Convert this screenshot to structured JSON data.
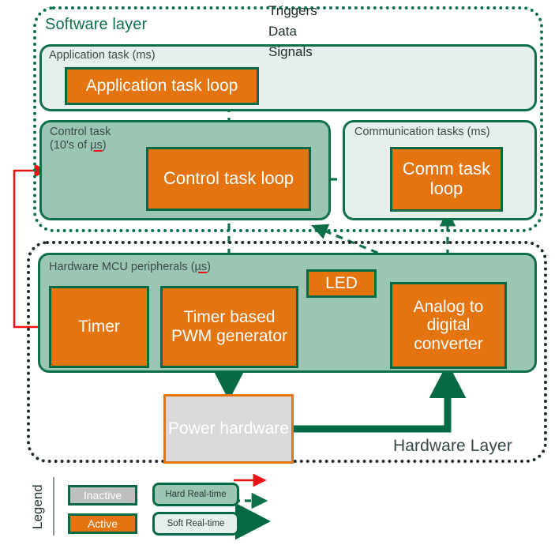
{
  "diagram": {
    "layers": {
      "software": {
        "title": "Software layer"
      },
      "hardware": {
        "title": "Hardware Layer"
      }
    },
    "groups": {
      "application_task": {
        "label": "Application task (ms)",
        "realtime": "soft"
      },
      "control_task": {
        "label": "Control task\n(10's of µs)",
        "label_line1": "Control task",
        "label_line2": "(10's of µs)",
        "realtime": "hard"
      },
      "communication_tasks": {
        "label": "Communication tasks (ms)",
        "realtime": "soft"
      },
      "mcu_peripherals": {
        "label": "Hardware MCU peripherals (µs)",
        "realtime": "hard"
      }
    },
    "blocks": {
      "application_task_loop": {
        "label": "Application task loop",
        "state": "Active"
      },
      "control_task_loop": {
        "label": "Control task loop",
        "state": "Active"
      },
      "comm_task_loop": {
        "label": "Comm task loop",
        "state": "Active"
      },
      "timer": {
        "label": "Timer",
        "state": "Active"
      },
      "pwm_generator": {
        "label": "Timer based PWM generator",
        "state": "Active"
      },
      "led": {
        "label": "LED",
        "state": "Active"
      },
      "adc": {
        "label": "Analog to digital converter",
        "state": "Active"
      },
      "power_hardware": {
        "label": "Power hardware",
        "state": "Inactive"
      }
    },
    "legend": {
      "title": "Legend",
      "state_chips": [
        {
          "label": "Inactive",
          "color": "#bfbfbf"
        },
        {
          "label": "Active",
          "color": "#e3740f"
        }
      ],
      "realtime_pills": [
        {
          "label": "Hard Real-time",
          "color": "#9cc6b4"
        },
        {
          "label": "Soft Real-time",
          "color": "#e6efec"
        }
      ],
      "arrow_kinds": [
        {
          "label": "Triggers",
          "color": "#ee1111",
          "style": "solid-thin"
        },
        {
          "label": "Data",
          "color": "#0d7049",
          "style": "dashed"
        },
        {
          "label": "Signals",
          "color": "#046a43",
          "style": "solid-thick"
        }
      ]
    },
    "colors": {
      "active": "#e3740f",
      "inactive": "#d9d9d9",
      "hard_realtime": "#9cc6b4",
      "soft_realtime": "#e6efec",
      "green_stroke": "#046a43",
      "software_border": "#0d7049",
      "hardware_border": "#1e2d2b",
      "trigger_red": "#ee1111",
      "label_gray": "#3d4a4a"
    },
    "connections": [
      {
        "from": "application_task_loop",
        "to": "control_task_loop",
        "kind": "Data"
      },
      {
        "from": "comm_task_loop",
        "to": "control_task_loop",
        "kind": "Data"
      },
      {
        "from": "control_task_loop",
        "to": "pwm_generator",
        "kind": "Data"
      },
      {
        "from": "adc",
        "to": "control_task_loop",
        "kind": "Data"
      },
      {
        "from": "adc",
        "to": "comm_task_loop",
        "kind": "Data"
      },
      {
        "from": "timer",
        "to": "control_task",
        "kind": "Triggers"
      },
      {
        "from": "pwm_generator",
        "to": "adc",
        "kind": "Triggers"
      },
      {
        "from": "pwm_generator",
        "to": "power_hardware",
        "kind": "Signals"
      },
      {
        "from": "power_hardware",
        "to": "adc",
        "kind": "Signals"
      }
    ]
  }
}
